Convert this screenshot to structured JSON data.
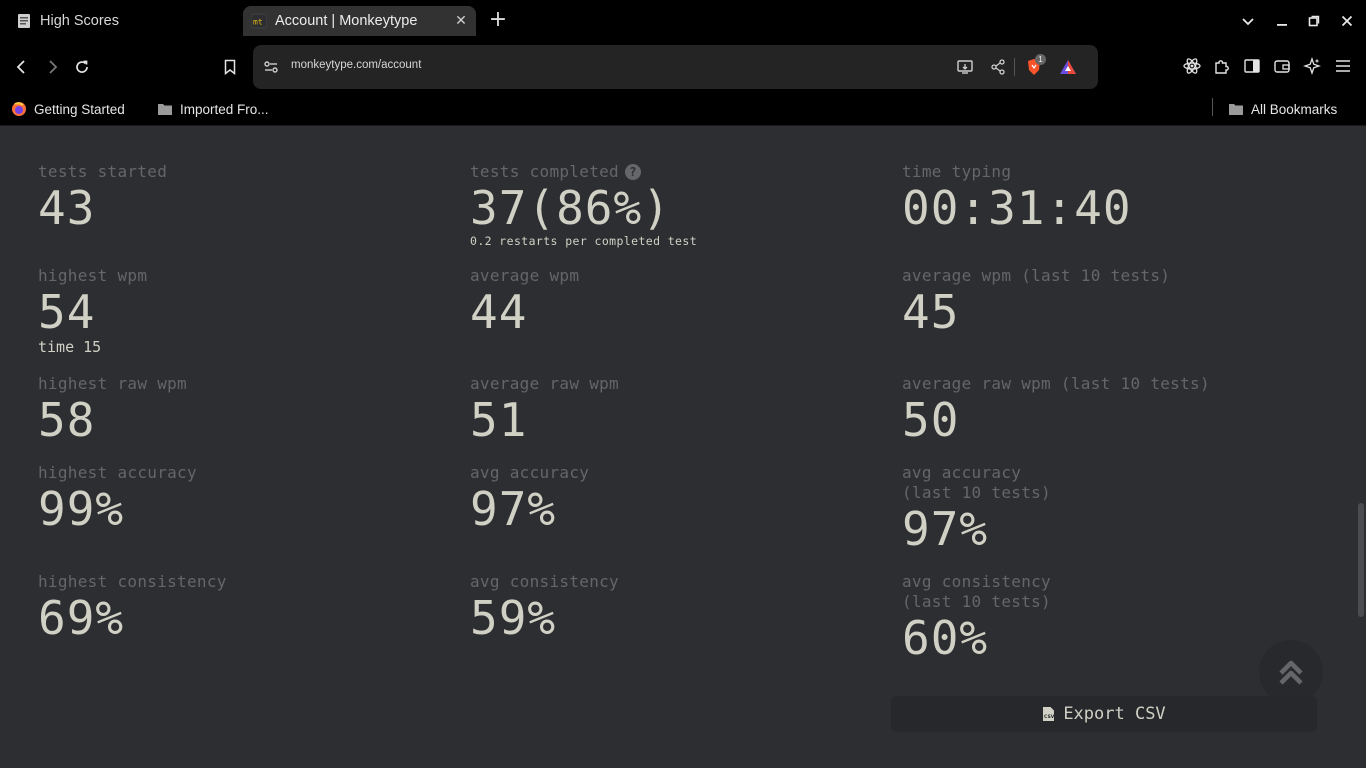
{
  "browser": {
    "tabs": [
      {
        "title": "High Scores",
        "active": false
      },
      {
        "title": "Account | Monkeytype",
        "active": true
      }
    ],
    "url": "monkeytype.com/account",
    "brave_badge": "1",
    "bookmarks": [
      {
        "label": "Getting Started"
      },
      {
        "label": "Imported Fro..."
      }
    ],
    "all_bookmarks": "All Bookmarks"
  },
  "stats": {
    "tests_started": {
      "label": "tests started",
      "value": "43"
    },
    "tests_completed": {
      "label": "tests completed",
      "value": "37(86%)",
      "sub": "0.2 restarts per completed test"
    },
    "time_typing": {
      "label": "time typing",
      "value": "00:31:40"
    },
    "highest_wpm": {
      "label": "highest wpm",
      "value": "54",
      "sub": "time 15"
    },
    "average_wpm": {
      "label": "average wpm",
      "value": "44"
    },
    "average_wpm_last10": {
      "label": "average wpm (last 10 tests)",
      "value": "45"
    },
    "highest_raw_wpm": {
      "label": "highest raw wpm",
      "value": "58"
    },
    "average_raw_wpm": {
      "label": "average raw wpm",
      "value": "51"
    },
    "average_raw_wpm_last10": {
      "label": "average raw wpm (last 10 tests)",
      "value": "50"
    },
    "highest_accuracy": {
      "label": "highest accuracy",
      "value": "99%"
    },
    "avg_accuracy": {
      "label": "avg accuracy",
      "value": "97%"
    },
    "avg_accuracy_last10": {
      "label": "avg accuracy\n(last 10 tests)",
      "value": "97%"
    },
    "highest_consistency": {
      "label": "highest consistency",
      "value": "69%"
    },
    "avg_consistency": {
      "label": "avg consistency",
      "value": "59%"
    },
    "avg_consistency_last10": {
      "label": "avg consistency\n(last 10 tests)",
      "value": "60%"
    }
  },
  "actions": {
    "export_label": "Export CSV"
  },
  "theme": {
    "bg": "#2c2e31",
    "sub": "#646669",
    "text": "#d1d0c5"
  }
}
